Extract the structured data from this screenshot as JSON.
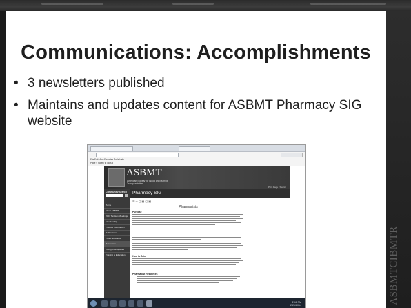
{
  "slide": {
    "title": "Communications:  Accomplishments",
    "bullets": [
      "3 newsletters published",
      "Maintains and updates content for ASBMT Pharmacy SIG website"
    ]
  },
  "watermark": {
    "lines": [
      "ASBMT",
      "CIBMTR"
    ]
  },
  "screenshot": {
    "tab_label": "Pharmacy SIG - Internet Ex...",
    "menu": "File  Edit  View  Favorites  Tools  Help",
    "tools": "Page ▾  Safety ▾  Tools ▾",
    "logo_text": "ASBMT",
    "logo_sub": "American Society for Blood and Marrow Transplantation",
    "header_links": "Print Page  |  Search",
    "sidebar": {
      "search_label": "Community Search",
      "items": [
        "Home",
        "About ASBMT",
        "2007 Tandem Meetings",
        "Membership",
        "Practice Information",
        "Publications",
        "Public Education",
        "Resources",
        "Young Investigators",
        "Training & Education"
      ]
    },
    "page_heading": "Pharmacy SIG",
    "page_subtitle": "Pharmacists",
    "section_headings": [
      "Purpose",
      "How to Join",
      "Pharmacist Resources"
    ],
    "clock": "2:46 PM\n2/21/2014"
  },
  "colors": {
    "slide_bg": "#ffffff",
    "frame_bg": "#1a1a1a",
    "site_header": "#3a3a3a",
    "text": "#1f1f1f"
  }
}
